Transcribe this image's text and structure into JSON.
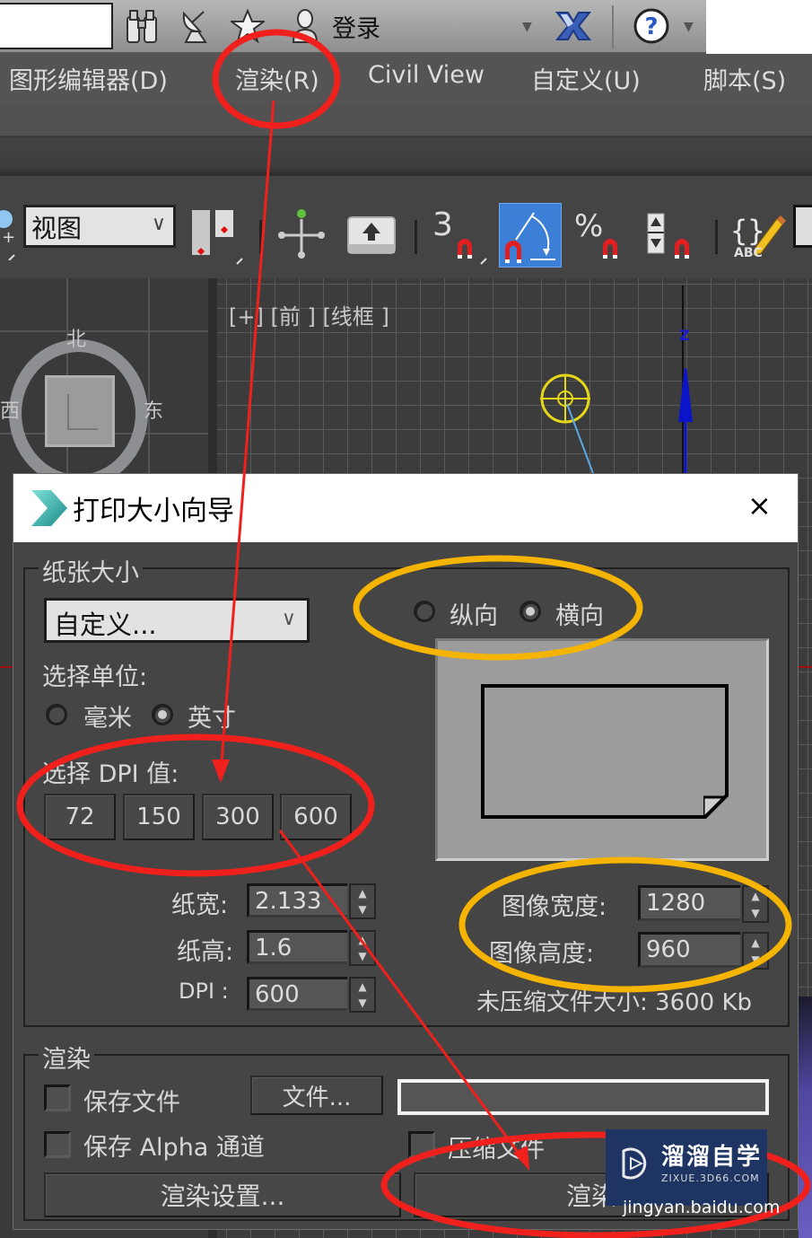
{
  "topbar": {
    "search_value": "",
    "icons": [
      "binoculars-icon",
      "satellite-dish-icon",
      "star-icon",
      "user-icon"
    ],
    "login_label": "登录",
    "exchange_icon": "autodesk-exchange-x-icon",
    "help_icon": "help-question-icon"
  },
  "menubar": {
    "items": [
      {
        "label": "图形编辑器(D)"
      },
      {
        "label": "渲染(R)"
      },
      {
        "label": "Civil View"
      },
      {
        "label": "自定义(U)"
      },
      {
        "label": "脚本(S)"
      }
    ]
  },
  "toolbar": {
    "view_select_value": "视图",
    "buttons": [
      "use-pivot-center-icon",
      "select-manipulate-icon",
      "keyboard-shortcut-override-icon",
      "snaps-toggle-3d-icon",
      "angle-snap-toggle-icon",
      "percent-snap-toggle-icon",
      "spinner-snap-toggle-icon",
      "edit-named-selection-sets-icon"
    ],
    "snap_3_label": "3",
    "percent_label": "%",
    "abc_label": "ABC"
  },
  "viewport": {
    "label": "[+] [前 ] [线框 ]",
    "compass": {
      "north": "北",
      "west": "西",
      "east": "东"
    },
    "axis_label": "Z"
  },
  "dialog": {
    "title": "打印大小向导",
    "close_label": "×",
    "paper_group": {
      "label": "纸张大小",
      "paper_select_value": "自定义...",
      "unit_label": "选择单位:",
      "units": [
        {
          "label": "毫米",
          "selected": false
        },
        {
          "label": "英寸",
          "selected": true
        }
      ],
      "orientation": [
        {
          "label": "纵向",
          "selected": false
        },
        {
          "label": "横向",
          "selected": true
        }
      ],
      "dpi_label": "选择 DPI 值:",
      "dpi_buttons": [
        "72",
        "150",
        "300",
        "600"
      ],
      "paper_width_label": "纸宽:",
      "paper_width_value": "2.133",
      "paper_height_label": "纸高:",
      "paper_height_value": "1.6",
      "dpi_field_label": "DPI :",
      "dpi_field_value": "600",
      "image_width_label": "图像宽度:",
      "image_width_value": "1280",
      "image_height_label": "图像高度:",
      "image_height_value": "960",
      "filesize_label": "未压缩文件大小: 3600 Kb"
    },
    "render_group": {
      "label": "渲染",
      "save_file_label": "保存文件",
      "save_file_checked": false,
      "file_button_label": "文件...",
      "file_path_value": "",
      "save_alpha_label": "保存 Alpha 通道",
      "save_alpha_checked": false,
      "compress_label": "压缩文件",
      "compress_checked": false,
      "render_settings_label": "渲染设置...",
      "render_button_label": "渲染"
    }
  },
  "watermark": {
    "title": "溜溜自学",
    "subtitle": "ZIXUE.3D66.COM",
    "source": "jingyan.baidu.com"
  },
  "colors": {
    "annotation_red": "#f0201c",
    "annotation_yellow": "#f5b400",
    "active_blue": "#3b7fd6"
  }
}
